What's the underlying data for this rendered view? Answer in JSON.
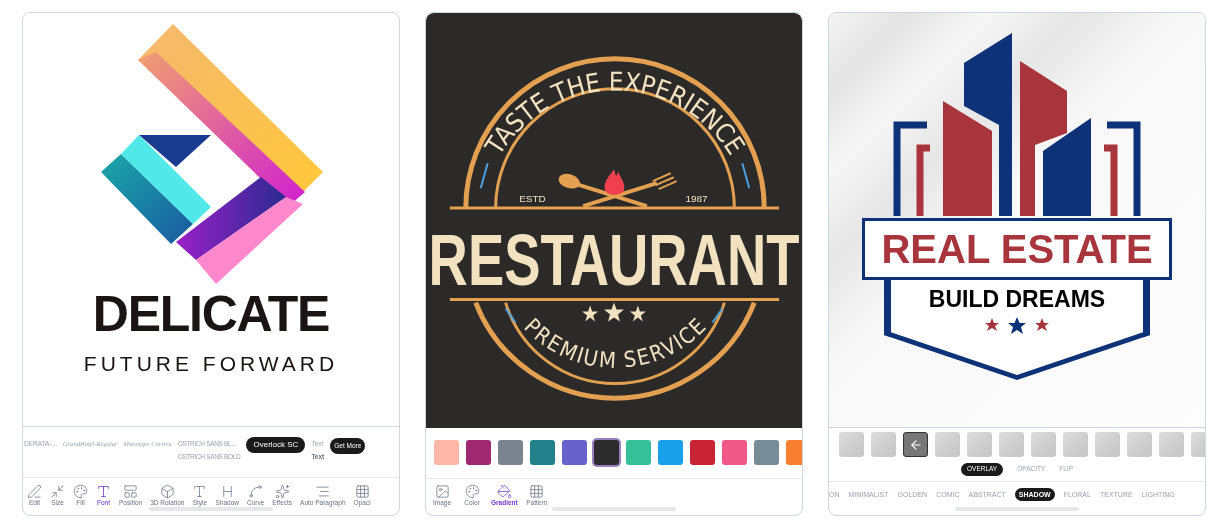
{
  "screens": [
    {
      "kind": "font",
      "logo": {
        "title": "DELICATE",
        "tagline": "FUTURE FORWARD"
      },
      "fonts": [
        {
          "label": "DERATA-...",
          "kind": "plain",
          "selected": false
        },
        {
          "label": "GrandHotel-Regular",
          "kind": "script",
          "selected": false
        },
        {
          "label": "Monotype Corsiva",
          "kind": "italic",
          "selected": false
        },
        {
          "label": "OSTRICH SANS BL...",
          "sub": "OSTRICH SANS BOLD",
          "kind": "condensed",
          "selected": false
        },
        {
          "label": "Overlock SC",
          "kind": "smallcaps",
          "selected": true
        },
        {
          "label": "Text",
          "sub": "Text",
          "kind": "plain",
          "selected": false
        }
      ],
      "get_more": "Get More",
      "tools": [
        {
          "label": "Edit",
          "selected": false
        },
        {
          "label": "Size",
          "selected": false
        },
        {
          "label": "Fill",
          "selected": false
        },
        {
          "label": "Font",
          "selected": true
        },
        {
          "label": "Position",
          "selected": false
        },
        {
          "label": "3D Rotation",
          "selected": false
        },
        {
          "label": "Style",
          "selected": false
        },
        {
          "label": "Shadow",
          "selected": false
        },
        {
          "label": "Curve",
          "selected": false
        },
        {
          "label": "Effects",
          "selected": false
        },
        {
          "label": "Auto Paragraph",
          "selected": false
        },
        {
          "label": "Opaci",
          "selected": false
        }
      ]
    },
    {
      "kind": "background",
      "logo": {
        "arc_top": "TASTE THE EXPERIENCE",
        "estd": "ESTD",
        "year": "1987",
        "title": "RESTAURANT",
        "arc_bottom": "PREMIUM SERVICE"
      },
      "swatches": [
        {
          "color": "#ffb8a8",
          "selected": false
        },
        {
          "color": "#a02870",
          "selected": false
        },
        {
          "color": "#7a848e",
          "selected": false
        },
        {
          "color": "#22808a",
          "selected": false
        },
        {
          "color": "#6a62cc",
          "selected": false
        },
        {
          "color": "#2c2c2c",
          "selected": true
        },
        {
          "color": "#36c098",
          "selected": false
        },
        {
          "color": "#1aa0e8",
          "selected": false
        },
        {
          "color": "#c82434",
          "selected": false
        },
        {
          "color": "#f05888",
          "selected": false
        },
        {
          "color": "#788c98",
          "selected": false
        },
        {
          "color": "#f88030",
          "selected": false
        }
      ],
      "tabs": [
        {
          "label": "Image",
          "selected": false
        },
        {
          "label": "Color",
          "selected": false
        },
        {
          "label": "Gradient",
          "selected": true
        },
        {
          "label": "Pattern",
          "selected": false
        }
      ]
    },
    {
      "kind": "texture",
      "logo": {
        "title": "REAL ESTATE",
        "tagline": "BUILD DREAMS"
      },
      "textures": [
        {
          "selected": false
        },
        {
          "selected": false
        },
        {
          "selected": true
        },
        {
          "selected": false
        },
        {
          "selected": false
        },
        {
          "selected": false
        },
        {
          "selected": false
        },
        {
          "selected": false
        },
        {
          "selected": false
        },
        {
          "selected": false
        },
        {
          "selected": false
        },
        {
          "selected": false
        }
      ],
      "modes": [
        {
          "label": "OVERLAY",
          "selected": true
        },
        {
          "label": "OPACITY",
          "selected": false
        },
        {
          "label": "FLIP",
          "selected": false
        }
      ],
      "categories": [
        {
          "label": "ON",
          "selected": false
        },
        {
          "label": "MINIMALIST",
          "selected": false
        },
        {
          "label": "GOLDEN",
          "selected": false
        },
        {
          "label": "COMIC",
          "selected": false
        },
        {
          "label": "ABSTRACT",
          "selected": false
        },
        {
          "label": "SHADOW",
          "selected": true
        },
        {
          "label": "FLORAL",
          "selected": false
        },
        {
          "label": "TEXTURE",
          "selected": false
        },
        {
          "label": "LIGHTING",
          "selected": false
        }
      ]
    }
  ]
}
